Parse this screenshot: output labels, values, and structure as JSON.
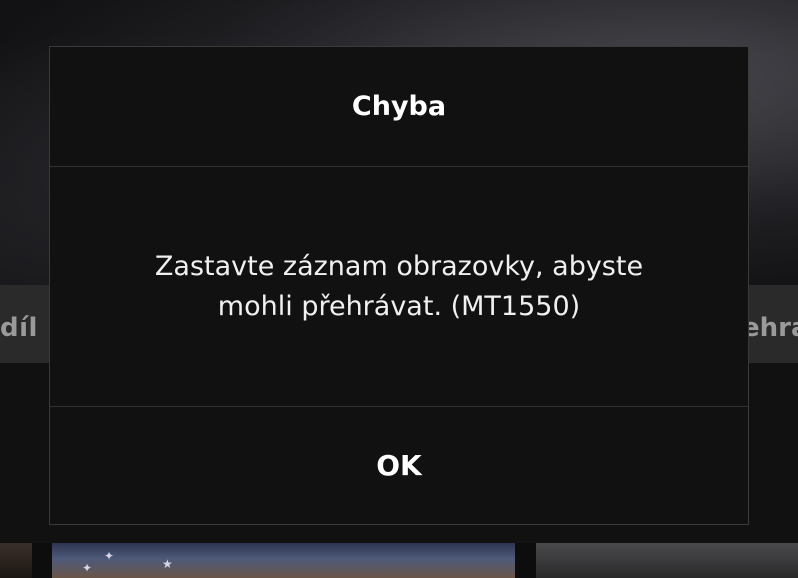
{
  "background": {
    "left_button_label": "díl",
    "right_button_label": "ehra"
  },
  "dialog": {
    "title": "Chyba",
    "message": "Zastavte záznam obrazovky, abyste mohli přehrávat. (MT1550)",
    "ok_label": "OK"
  }
}
